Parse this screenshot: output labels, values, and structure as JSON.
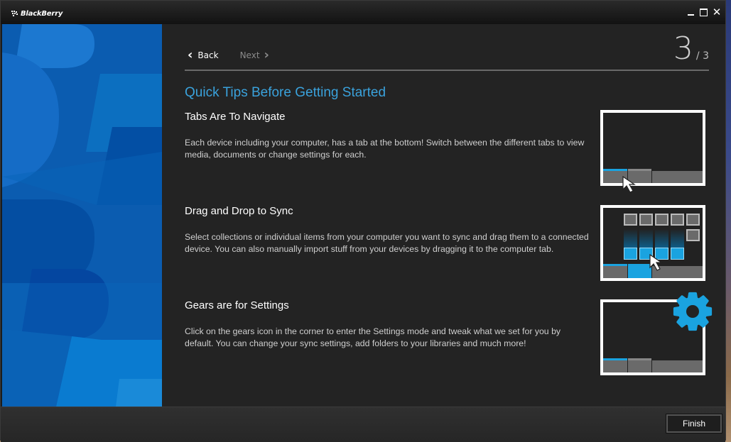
{
  "window": {
    "app_name": "BlackBerry",
    "controls": {
      "minimize": "minimize",
      "maximize": "maximize",
      "close": "✕"
    }
  },
  "nav": {
    "back_label": "Back",
    "next_label": "Next",
    "back_icon": "‹",
    "next_icon": "›",
    "step_current": "3",
    "step_total": "/ 3"
  },
  "main": {
    "title": "Quick Tips Before Getting Started",
    "tips": [
      {
        "heading": "Tabs Are To Navigate",
        "body": "Each device including your computer, has a tab at the bottom! Switch between the different tabs to view media, documents or change settings for each.",
        "illustration": "tabs-navigation-illustration"
      },
      {
        "heading": "Drag and Drop to Sync",
        "body": "Select collections or individual items from your computer you want to sync and drag them to a connected device. You can also manually import stuff from your devices by dragging it to the computer tab.",
        "illustration": "drag-drop-illustration"
      },
      {
        "heading": "Gears are for Settings",
        "body": "Click on the gears icon in the corner to enter the Settings mode and tweak what we set for you by default. You can change your sync settings, add folders to your libraries and much more!",
        "illustration": "gear-settings-illustration"
      }
    ]
  },
  "footer": {
    "finish_label": "Finish"
  },
  "colors": {
    "accent": "#3aa2dc",
    "tab_blue": "#1aa3e0",
    "sidebar_blue": "#0a5cb4",
    "panel_bg": "#232323"
  }
}
